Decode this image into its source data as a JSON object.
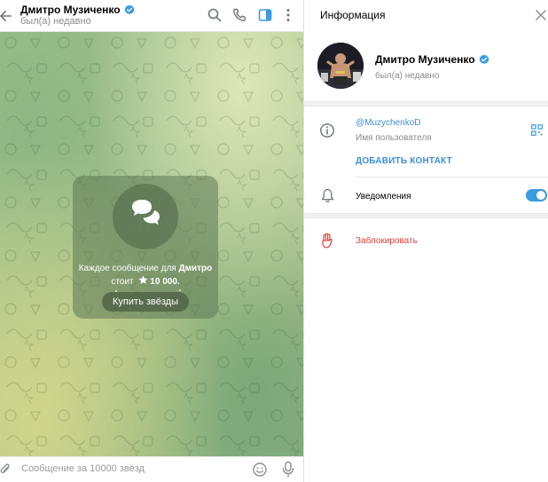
{
  "chat": {
    "name": "Дмитро Музиченко",
    "status": "был(а) недавно",
    "paid_message": {
      "text_prefix": "Каждое сообщение для ",
      "name_bold": "Дмитро",
      "text_line2": "стоит",
      "price": "10 000.",
      "buy_button": "Купить звёзды"
    },
    "composer": {
      "placeholder": "Сообщение за 10000 звёзд"
    }
  },
  "info": {
    "title": "Информация",
    "profile": {
      "name": "Дмитро Музиченко",
      "status": "был(а) недавно"
    },
    "username": "@MuzychenkoD",
    "username_label": "Имя пользователя",
    "add_contact": "ДОБАВИТЬ КОНТАКТ",
    "notifications_label": "Уведомления",
    "notifications_enabled": true,
    "block": "Заблокировать"
  },
  "colors": {
    "accent": "#3a8fd9",
    "danger": "#e0403a",
    "verified": "#3a9be0"
  },
  "icons": {
    "back": "arrow-left-icon",
    "search": "search-icon",
    "call": "phone-icon",
    "sidebar": "sidebar-toggle-icon",
    "more": "more-vertical-icon",
    "close": "close-icon",
    "info": "info-icon",
    "qr": "qr-code-icon",
    "bell": "bell-icon",
    "block": "hand-stop-icon",
    "attach": "paperclip-icon",
    "emoji": "emoji-icon",
    "mic": "microphone-icon"
  }
}
